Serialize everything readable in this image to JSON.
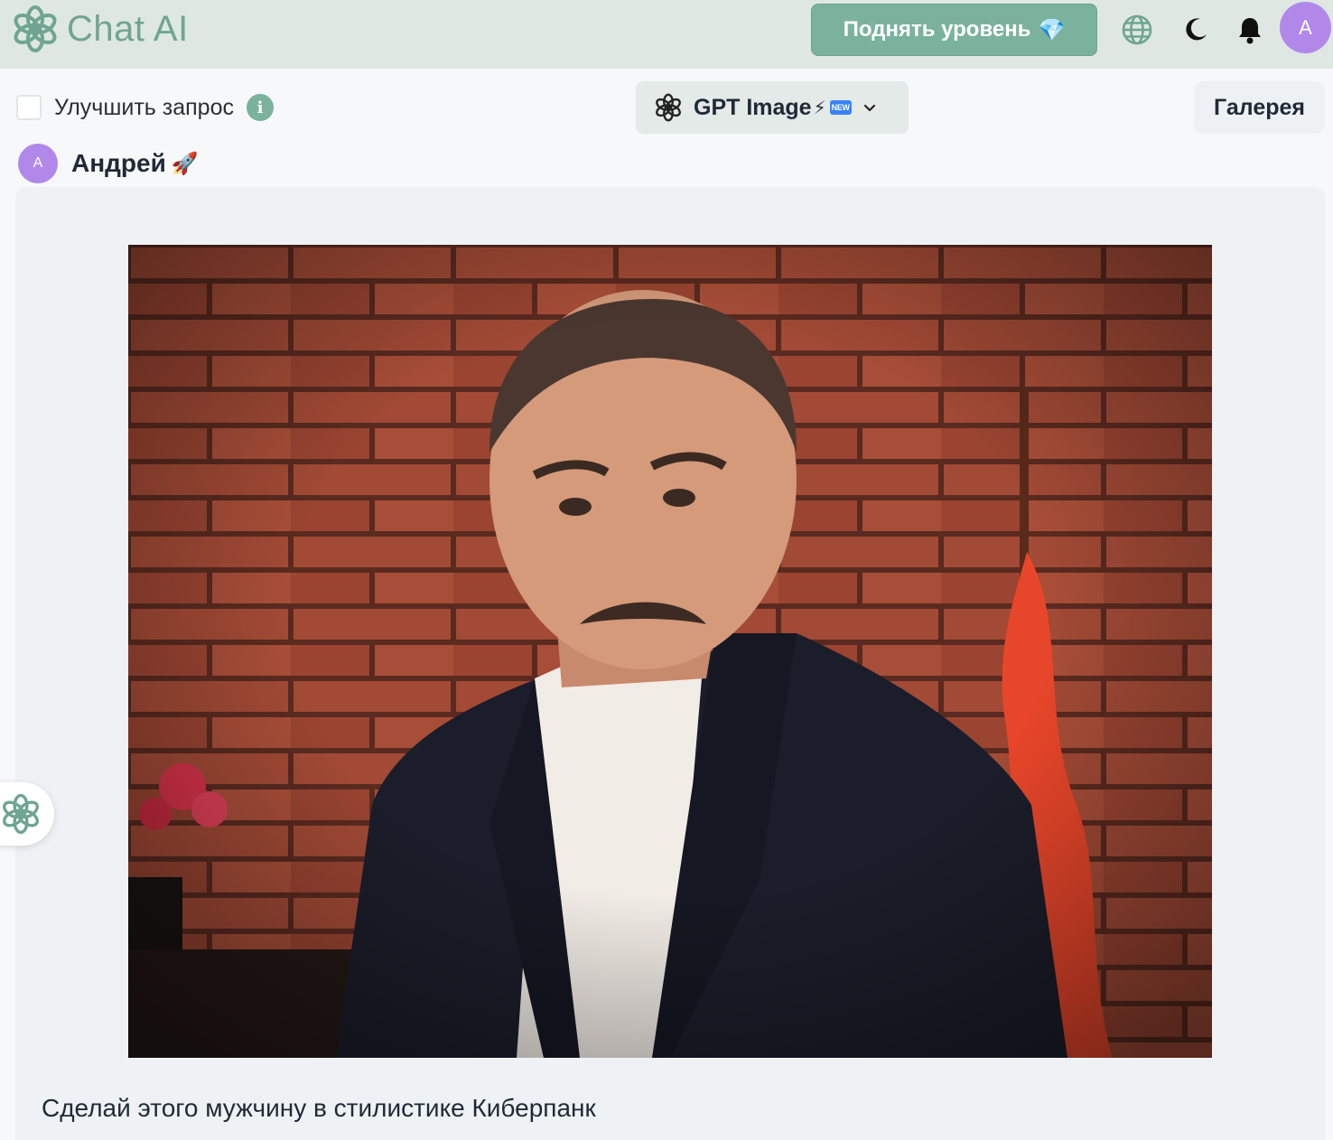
{
  "header": {
    "app_name": "Chat AI",
    "upgrade_label": "Поднять уровень",
    "upgrade_icon": "💎",
    "avatar_letter": "A",
    "icons": [
      "openai-logo-icon",
      "globe-icon",
      "moon-icon",
      "bell-icon"
    ]
  },
  "toolbar": {
    "improve_label": "Улучшить запрос",
    "improve_checked": false,
    "info_glyph": "i",
    "model": {
      "name": "GPT Image",
      "bolt": "⚡",
      "badge": "NEW"
    },
    "gallery_label": "Галерея"
  },
  "message": {
    "author": "Андрей",
    "author_emoji": "🚀",
    "avatar_letter": "A",
    "image_alt": "photo of a man in a dark suit in front of a brick wall with a red flag",
    "prompt": "Сделай этого мужчину в стилистике Киберпанк"
  },
  "colors": {
    "accent": "#7ab29d",
    "header_bg": "#dfe7e3",
    "avatar": "#b287ea",
    "bubble_bg": "#eef2f5"
  }
}
